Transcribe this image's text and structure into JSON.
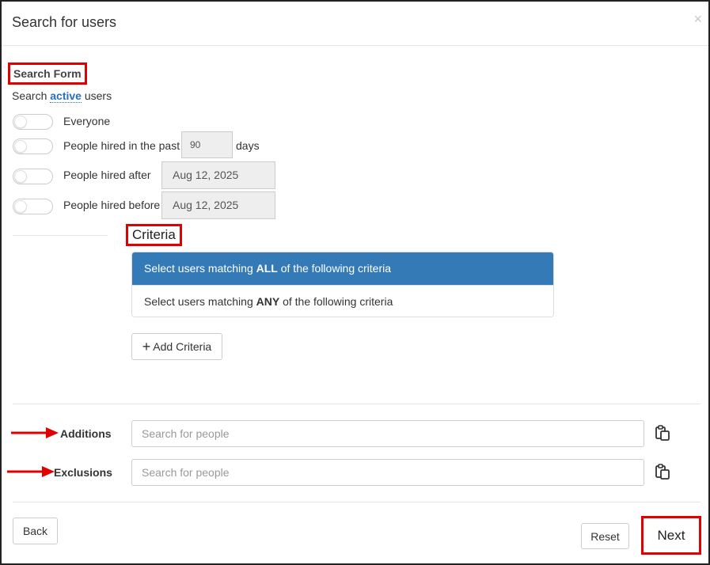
{
  "header": {
    "title": "Search for users",
    "close_glyph": "×"
  },
  "search_form": {
    "label": "Search Form",
    "intro_prefix": "Search ",
    "intro_active": "active",
    "intro_suffix": " users",
    "options": {
      "everyone": "Everyone",
      "hired_past_label": "People hired in the past",
      "hired_past_value": "90",
      "hired_past_unit": "days",
      "hired_after_label": "People hired after",
      "hired_after_value": "Aug 12, 2025",
      "hired_before_label": "People hired before",
      "hired_before_value": "Aug 12, 2025"
    }
  },
  "criteria": {
    "label": "Criteria",
    "all_prefix": "Select users matching ",
    "all_bold": "ALL",
    "all_suffix": " of the following criteria",
    "any_prefix": "Select users matching ",
    "any_bold": "ANY",
    "any_suffix": " of the following criteria",
    "add_label": "Add Criteria",
    "add_glyph": "+"
  },
  "additions": {
    "label": "Additions",
    "placeholder": "Search for people"
  },
  "exclusions": {
    "label": "Exclusions",
    "placeholder": "Search for people"
  },
  "footer": {
    "back": "Back",
    "reset": "Reset",
    "next": "Next"
  },
  "colors": {
    "accent": "#337ab7",
    "annotation_red": "#e00000",
    "link_blue": "#2a6ebb"
  }
}
